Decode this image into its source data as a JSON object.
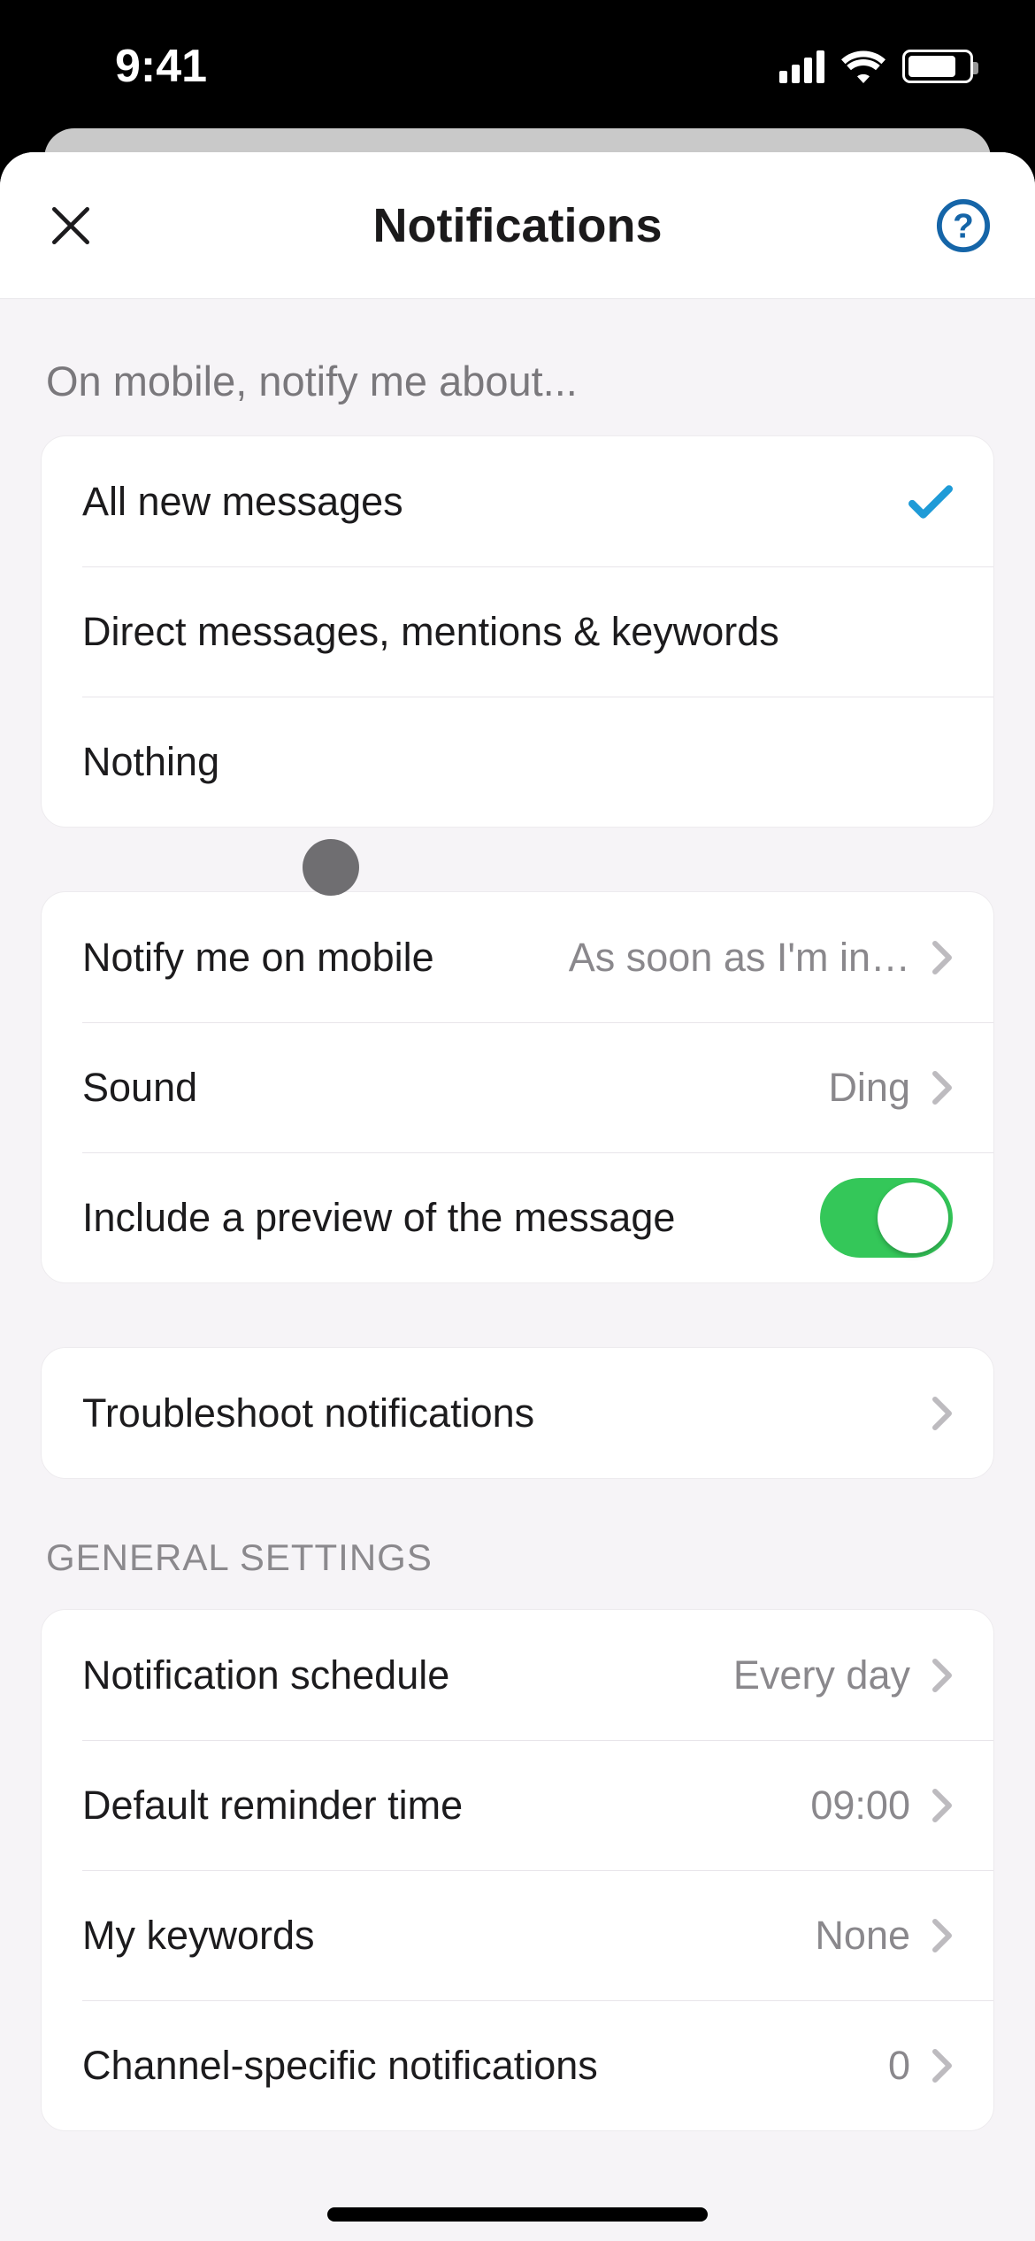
{
  "status": {
    "time": "9:41"
  },
  "header": {
    "title": "Notifications"
  },
  "section1": {
    "label": "On mobile, notify me about...",
    "options": {
      "all": "All new messages",
      "dm": "Direct messages, mentions & keywords",
      "nothing": "Nothing"
    }
  },
  "section2": {
    "notify_when": {
      "label": "Notify me on mobile",
      "value": "As soon as I'm in…"
    },
    "sound": {
      "label": "Sound",
      "value": "Ding"
    },
    "preview": {
      "label": "Include a preview of the message",
      "enabled": true
    }
  },
  "troubleshoot": {
    "label": "Troubleshoot notifications"
  },
  "general": {
    "header": "General Settings",
    "schedule": {
      "label": "Notification schedule",
      "value": "Every day"
    },
    "reminder": {
      "label": "Default reminder time",
      "value": "09:00"
    },
    "keywords": {
      "label": "My keywords",
      "value": "None"
    },
    "channel": {
      "label": "Channel-specific notifications",
      "value": "0"
    }
  },
  "colors": {
    "accent_blue": "#1f9bd7",
    "toggle_green": "#34c759"
  }
}
